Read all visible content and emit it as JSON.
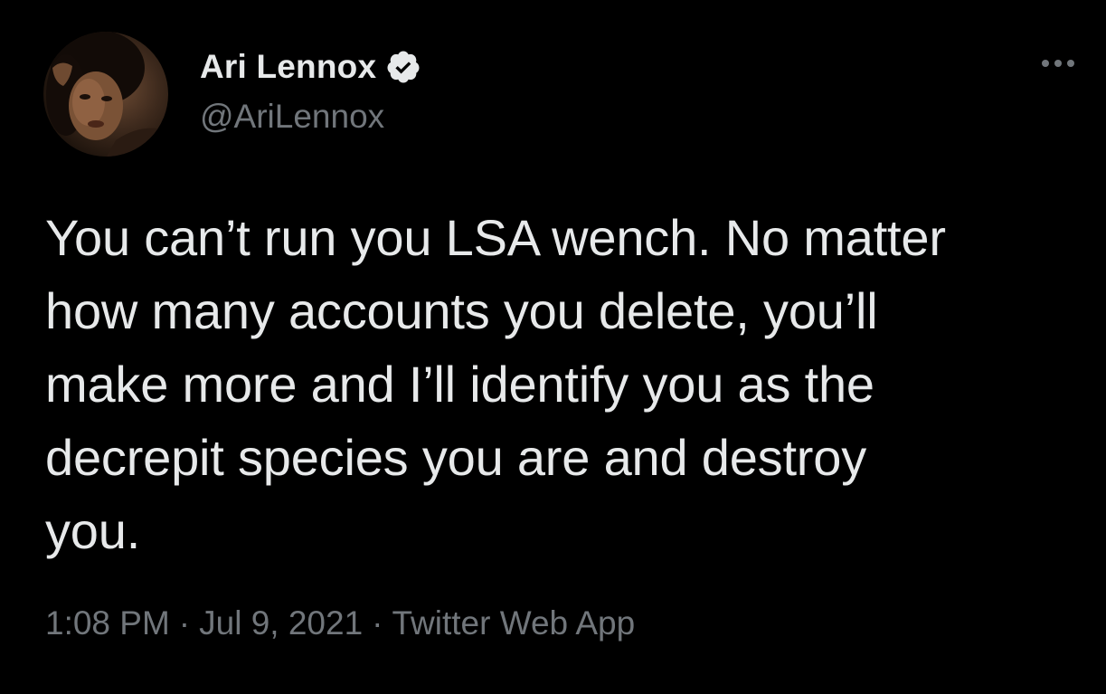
{
  "author": {
    "display_name": "Ari Lennox",
    "handle": "@AriLennox",
    "verified": true,
    "avatar_icon": "profile-photo"
  },
  "tweet": {
    "text": "You can’t run you LSA wench. No matter\nhow many accounts you delete, you’ll\nmake more and I’ll identify you as the\ndecrepit species you are and destroy\nyou."
  },
  "meta": {
    "time": "1:08 PM",
    "separator": "·",
    "date": "Jul 9, 2021",
    "source": "Twitter Web App"
  },
  "icons": {
    "verified": "verified-badge-icon",
    "more": "more-options-icon"
  },
  "colors": {
    "background": "#000000",
    "primary_text": "#e7e9ea",
    "secondary_text": "#71767b"
  }
}
